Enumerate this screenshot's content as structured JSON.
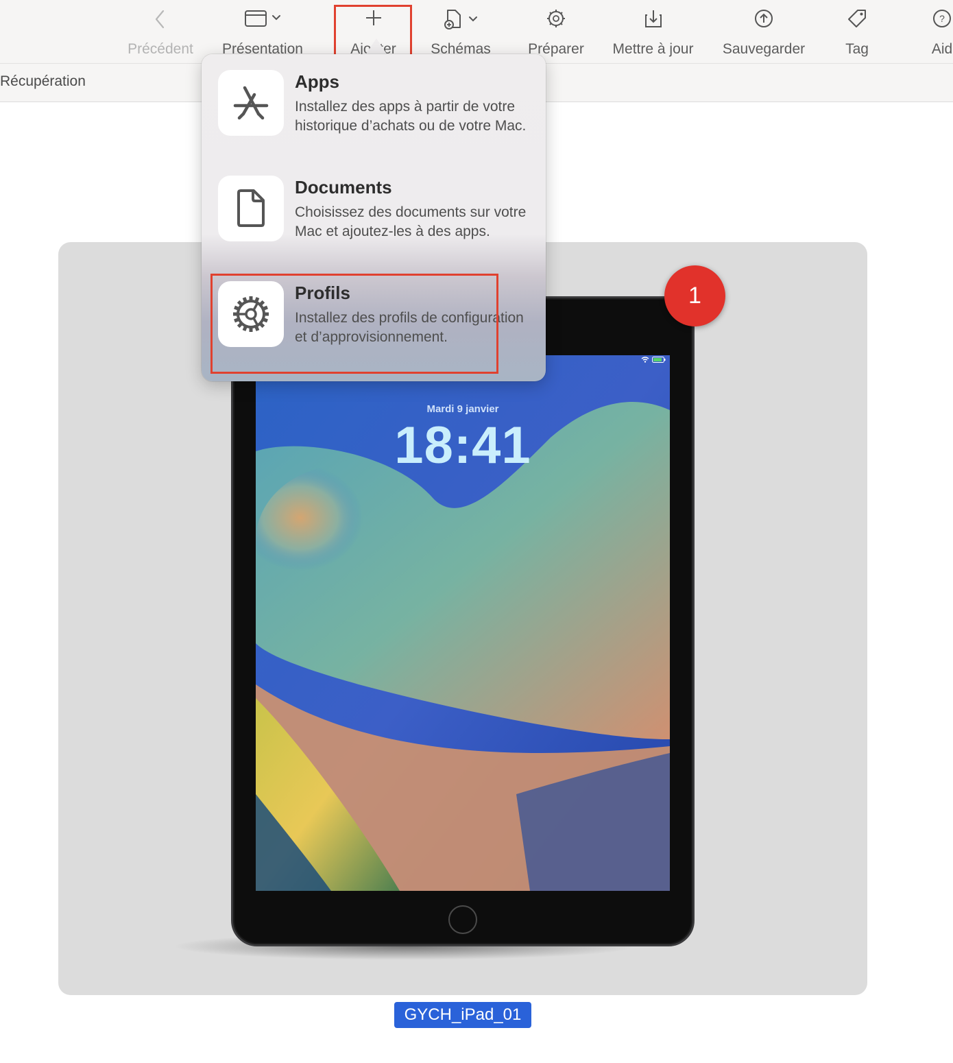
{
  "toolbar": {
    "items": [
      {
        "label": "Précédent",
        "icon": "chevron-left-icon"
      },
      {
        "label": "Présentation",
        "icon": "window-icon"
      },
      {
        "label": "Ajouter",
        "icon": "plus-icon"
      },
      {
        "label": "Schémas",
        "icon": "document-add-icon"
      },
      {
        "label": "Préparer",
        "icon": "gear-icon"
      },
      {
        "label": "Mettre à jour",
        "icon": "download-icon"
      },
      {
        "label": "Sauvegarder",
        "icon": "upload-circle-icon"
      },
      {
        "label": "Tag",
        "icon": "tag-icon"
      },
      {
        "label": "Aid",
        "icon": "help-icon"
      }
    ]
  },
  "subbar": {
    "label": "Récupération"
  },
  "popover": {
    "items": [
      {
        "title": "Apps",
        "description": "Installez des apps à partir de votre historique d’achats ou de votre Mac.",
        "icon": "app-store-icon"
      },
      {
        "title": "Documents",
        "description": "Choisissez des documents sur votre Mac et ajoutez-les à des apps.",
        "icon": "document-icon"
      },
      {
        "title": "Profils",
        "description": "Installez des profils de configuration et d’approvisionnement.",
        "icon": "settings-gear-icon"
      }
    ]
  },
  "device": {
    "lock_date": "Mardi 9 janvier",
    "lock_time": "18:41",
    "name": "GYCH_iPad_01"
  },
  "badge": {
    "number": "1"
  },
  "colors": {
    "highlight": "#e0412f",
    "badge": "#e1322b",
    "selection": "#2a62d9"
  }
}
